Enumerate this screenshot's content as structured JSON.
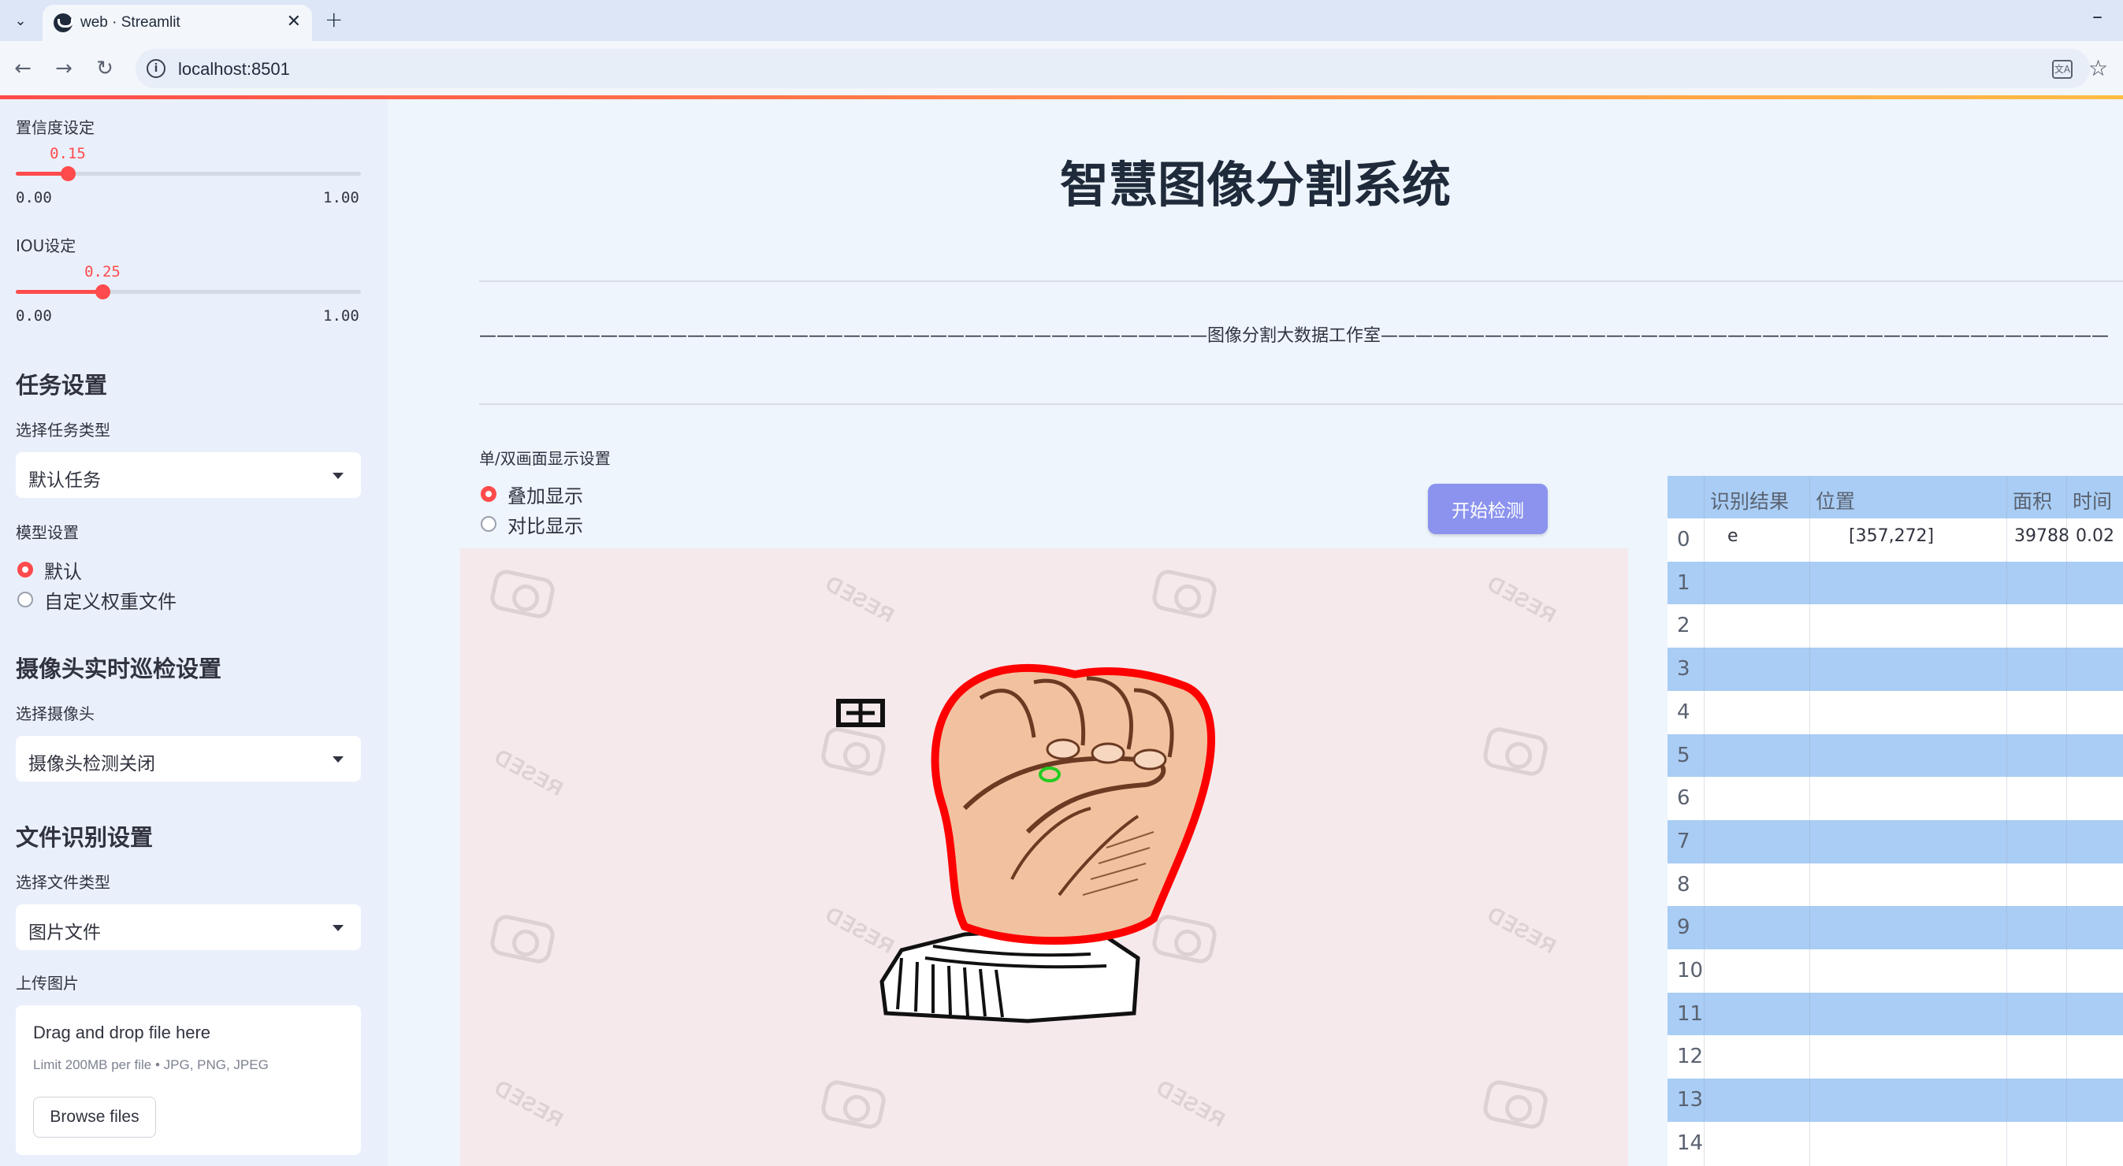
{
  "browser": {
    "tab_title": "web · Streamlit",
    "url": "localhost:8501"
  },
  "sidebar": {
    "confidence": {
      "label": "置信度设定",
      "value": "0.15",
      "value_num": 0.15,
      "min": "0.00",
      "max": "1.00"
    },
    "iou": {
      "label": "IOU设定",
      "value": "0.25",
      "value_num": 0.25,
      "min": "0.00",
      "max": "1.00"
    },
    "task_heading": "任务设置",
    "task_type_label": "选择任务类型",
    "task_type_value": "默认任务",
    "model_label": "模型设置",
    "model_options": [
      "默认",
      "自定义权重文件"
    ],
    "model_selected": 0,
    "camera_heading": "摄像头实时巡检设置",
    "camera_label": "选择摄像头",
    "camera_value": "摄像头检测关闭",
    "file_heading": "文件识别设置",
    "file_type_label": "选择文件类型",
    "file_type_value": "图片文件",
    "upload_label": "上传图片",
    "upload_title": "Drag and drop file here",
    "upload_limit": "Limit 200MB per file • JPG, PNG, JPEG",
    "browse_label": "Browse files"
  },
  "main": {
    "title": "智慧图像分割系统",
    "subtitle": "图像分割大数据工作室",
    "display_label": "单/双画面显示设置",
    "display_options": [
      "叠加显示",
      "对比显示"
    ],
    "display_selected": 0,
    "start_button": "开始检测",
    "detection_label": "e"
  },
  "table": {
    "headers": [
      "识别结果",
      "位置",
      "面积",
      "时间"
    ],
    "row_indices": [
      "0",
      "1",
      "2",
      "3",
      "4",
      "5",
      "6",
      "7",
      "8",
      "9",
      "10",
      "11",
      "12",
      "13",
      "14"
    ],
    "rows": [
      {
        "result": "e",
        "position": "[357,272]",
        "area": "39788",
        "time": "0.02"
      }
    ]
  },
  "colors": {
    "accent": "#ff4b4b",
    "button": "#8b93ee",
    "table_stripe": "#a9cdf5",
    "sidebar_bg": "#e9f0fb",
    "mask_outline": "#ff0000"
  }
}
